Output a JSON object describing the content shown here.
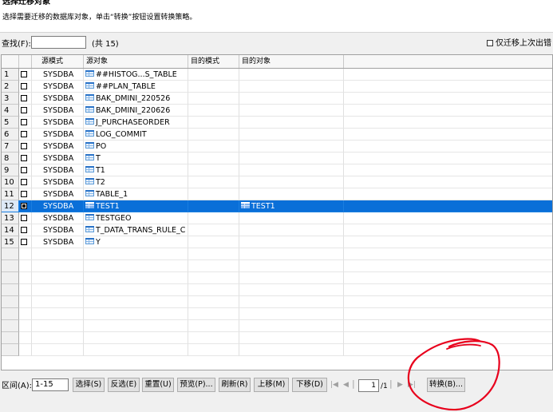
{
  "header": {
    "title": "选择迁移对象",
    "description": "选择需要迁移的数据库对象，单击“转换”按钮设置转换策略。"
  },
  "toolbar": {
    "find_label": "查找(F):",
    "find_value": "",
    "count_text": "(共 15)",
    "only_prev_label": "仅迁移上次出错"
  },
  "grid": {
    "columns": [
      "源模式",
      "源对象",
      "目的模式",
      "目的对象"
    ],
    "rows": [
      {
        "num": "1",
        "checked": false,
        "src_schema": "SYSDBA",
        "src_object": "##HISTOG...S_TABLE",
        "dst_schema": "",
        "dst_object": ""
      },
      {
        "num": "2",
        "checked": false,
        "src_schema": "SYSDBA",
        "src_object": "##PLAN_TABLE",
        "dst_schema": "",
        "dst_object": ""
      },
      {
        "num": "3",
        "checked": false,
        "src_schema": "SYSDBA",
        "src_object": "BAK_DMINI_220526",
        "dst_schema": "",
        "dst_object": ""
      },
      {
        "num": "4",
        "checked": false,
        "src_schema": "SYSDBA",
        "src_object": "BAK_DMINI_220626",
        "dst_schema": "",
        "dst_object": ""
      },
      {
        "num": "5",
        "checked": false,
        "src_schema": "SYSDBA",
        "src_object": "J_PURCHASEORDER",
        "dst_schema": "",
        "dst_object": ""
      },
      {
        "num": "6",
        "checked": false,
        "src_schema": "SYSDBA",
        "src_object": "LOG_COMMIT",
        "dst_schema": "",
        "dst_object": ""
      },
      {
        "num": "7",
        "checked": false,
        "src_schema": "SYSDBA",
        "src_object": "PO",
        "dst_schema": "",
        "dst_object": ""
      },
      {
        "num": "8",
        "checked": false,
        "src_schema": "SYSDBA",
        "src_object": "T",
        "dst_schema": "",
        "dst_object": ""
      },
      {
        "num": "9",
        "checked": false,
        "src_schema": "SYSDBA",
        "src_object": "T1",
        "dst_schema": "",
        "dst_object": ""
      },
      {
        "num": "10",
        "checked": false,
        "src_schema": "SYSDBA",
        "src_object": "T2",
        "dst_schema": "",
        "dst_object": ""
      },
      {
        "num": "11",
        "checked": false,
        "src_schema": "SYSDBA",
        "src_object": "TABLE_1",
        "dst_schema": "",
        "dst_object": ""
      },
      {
        "num": "12",
        "checked": true,
        "src_schema": "SYSDBA",
        "src_object": "TEST1",
        "dst_schema": "",
        "dst_object": "TEST1"
      },
      {
        "num": "13",
        "checked": false,
        "src_schema": "SYSDBA",
        "src_object": "TESTGEO",
        "dst_schema": "",
        "dst_object": ""
      },
      {
        "num": "14",
        "checked": false,
        "src_schema": "SYSDBA",
        "src_object": "T_DATA_TRANS_RULE_C",
        "dst_schema": "",
        "dst_object": ""
      },
      {
        "num": "15",
        "checked": false,
        "src_schema": "SYSDBA",
        "src_object": "Y",
        "dst_schema": "",
        "dst_object": ""
      }
    ],
    "empty_rows": 9,
    "selected_row": 12
  },
  "footer": {
    "range_label": "区间(A):",
    "range_value": "1-15",
    "buttons": {
      "select": "选择(S)",
      "invert": "反选(E)",
      "reset": "重置(U)",
      "preview": "预览(P)...",
      "refresh": "刷新(R)",
      "move_up": "上移(M)",
      "move_down": "下移(D)",
      "convert": "转换(B)..."
    },
    "page_value": "1",
    "page_total": "/1"
  },
  "colors": {
    "selection": "#0a6fd8",
    "annotation": "#e8001c"
  }
}
